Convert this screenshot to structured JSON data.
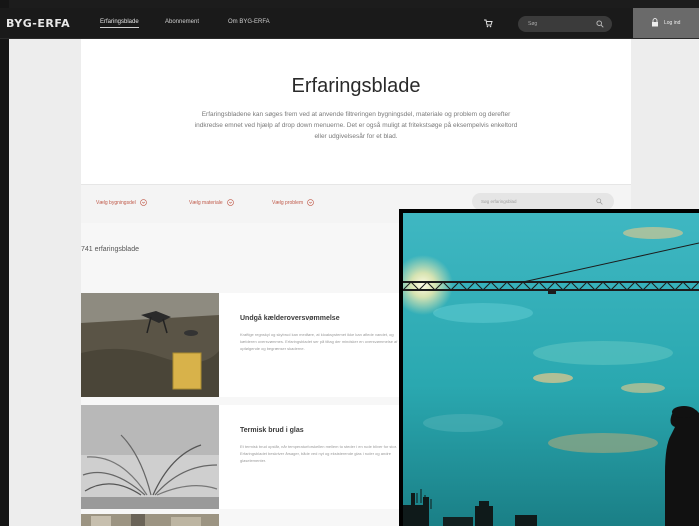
{
  "nav": {
    "logo": "BYG-ERFA",
    "links": [
      "Erfaringsblade",
      "Abonnement",
      "Om BYG-ERFA"
    ],
    "search_placeholder": "Søg",
    "login_label": "Log ind"
  },
  "hero": {
    "title": "Erfaringsblade",
    "intro": "Erfaringsbladene kan søges frem ved at anvende filtreringen bygningsdel, materiale og problem og derefter indkredse emnet ved hjælp af drop down menuerne. Det er også muligt at fritekstsøge på eksempelvis enkeltord eller udgivelsesår for et blad."
  },
  "filters": {
    "items": [
      "Vælg bygningsdel",
      "Vælg materiale",
      "Vælg problem"
    ],
    "search_placeholder": "Søg erfaringsblad"
  },
  "results": {
    "count_label": "741 erfaringsblade",
    "cards": [
      {
        "title": "Undgå kælderoversvømmelse",
        "desc": "Kraftige regnskyl og skybrud kan medføre, at kloaksystemet ikke kan aflede vandet, og kælderen oversvømmes. Erfaringsbladet ser på tiltag der mindsker en oversvømmelse af opfølgende og begrænser skaderne."
      },
      {
        "title": "Termisk brud i glas",
        "desc": "Et termisk brud opstår, når temperaturforskellen mellem to steder i en rude bliver for stor. Erfaringsbladet beskriver årsager, både ved nyt og eksisterende glas i ruder og andre glaselementer."
      }
    ]
  },
  "colors": {
    "nav_bg": "#1a1a1a",
    "accent": "#c05a4a",
    "login_bg": "#6a6a6a"
  }
}
